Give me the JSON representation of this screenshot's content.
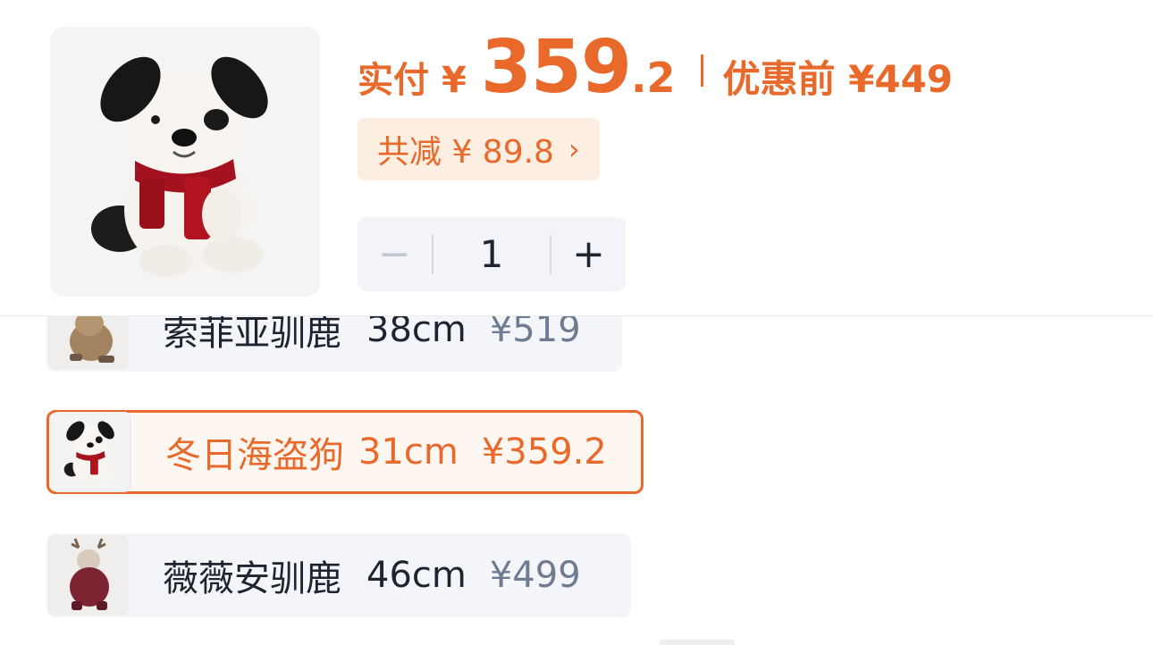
{
  "product": {
    "paid_label": "实付",
    "currency": "¥",
    "paid_int": "359",
    "paid_dec": ".2",
    "before_label": "优惠前 ¥449",
    "discount_label": "共减 ¥ 89.8",
    "discount_chevron": "›"
  },
  "quantity": {
    "minus": "−",
    "value": "1",
    "plus": "+"
  },
  "variants": [
    {
      "name": "索菲亚驯鹿",
      "size": "38cm",
      "price": "¥519",
      "selected": false,
      "icon": "reindeer-plush-brown"
    },
    {
      "name": "冬日海盗狗",
      "size": "31cm",
      "price": "¥359.2",
      "selected": true,
      "icon": "dog-plush-red-scarf"
    },
    {
      "name": "薇薇安驯鹿",
      "size": "46cm",
      "price": "¥499",
      "selected": false,
      "icon": "reindeer-plush-red-coat"
    }
  ],
  "colors": {
    "accent": "#e8692a",
    "accent_bg": "#fdeee2",
    "option_bg": "#f3f5f8",
    "muted_price": "#6f7b92"
  }
}
